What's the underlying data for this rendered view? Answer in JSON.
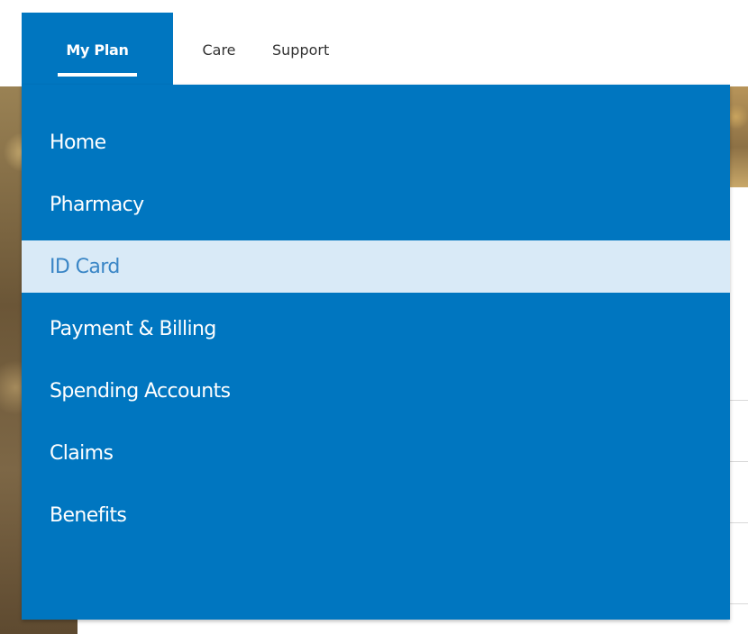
{
  "top_nav": {
    "tabs": [
      {
        "label": "My Plan",
        "active": true
      },
      {
        "label": "Care",
        "active": false
      },
      {
        "label": "Support",
        "active": false
      }
    ]
  },
  "dropdown": {
    "items": [
      {
        "label": "Home",
        "selected": false
      },
      {
        "label": "Pharmacy",
        "selected": false
      },
      {
        "label": "ID Card",
        "selected": true
      },
      {
        "label": "Payment & Billing",
        "selected": false
      },
      {
        "label": "Spending Accounts",
        "selected": false
      },
      {
        "label": "Claims",
        "selected": false
      },
      {
        "label": "Benefits",
        "selected": false
      }
    ]
  },
  "colors": {
    "brand_blue": "#0076c0",
    "selected_bg": "#d9eaf7",
    "selected_text": "#3a86c6",
    "tab_text": "#333333"
  }
}
